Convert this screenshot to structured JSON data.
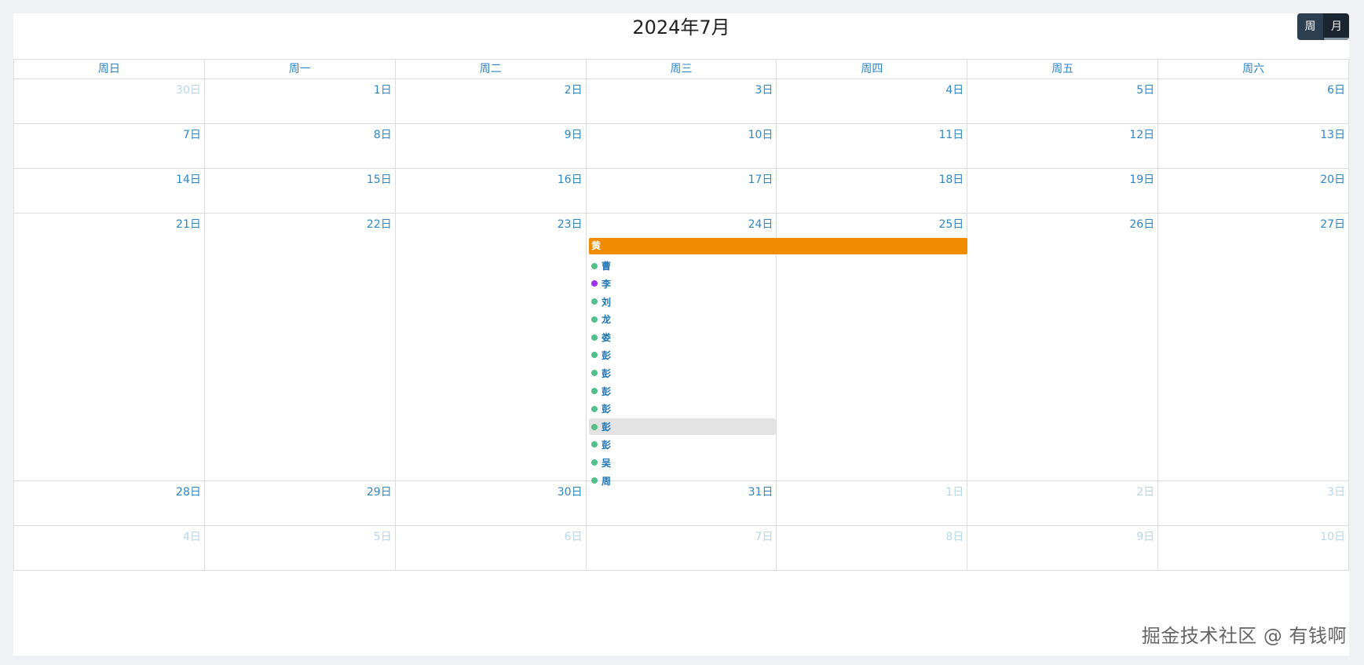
{
  "calendar": {
    "title": "2024年7月",
    "view_buttons": [
      {
        "label": "周",
        "active": false
      },
      {
        "label": "月",
        "active": true
      }
    ],
    "weekdays": [
      "周日",
      "周一",
      "周二",
      "周三",
      "周四",
      "周五",
      "周六"
    ],
    "weeks": [
      {
        "days": [
          {
            "label": "30日",
            "other": true
          },
          {
            "label": "1日"
          },
          {
            "label": "2日"
          },
          {
            "label": "3日"
          },
          {
            "label": "4日"
          },
          {
            "label": "5日"
          },
          {
            "label": "6日"
          }
        ]
      },
      {
        "days": [
          {
            "label": "7日"
          },
          {
            "label": "8日"
          },
          {
            "label": "9日"
          },
          {
            "label": "10日"
          },
          {
            "label": "11日"
          },
          {
            "label": "12日"
          },
          {
            "label": "13日"
          }
        ]
      },
      {
        "days": [
          {
            "label": "14日"
          },
          {
            "label": "15日"
          },
          {
            "label": "16日"
          },
          {
            "label": "17日"
          },
          {
            "label": "18日"
          },
          {
            "label": "19日"
          },
          {
            "label": "20日"
          }
        ]
      },
      {
        "days": [
          {
            "label": "21日"
          },
          {
            "label": "22日"
          },
          {
            "label": "23日"
          },
          {
            "label": "24日"
          },
          {
            "label": "25日"
          },
          {
            "label": "26日"
          },
          {
            "label": "27日"
          }
        ]
      },
      {
        "days": [
          {
            "label": "28日"
          },
          {
            "label": "29日"
          },
          {
            "label": "30日"
          },
          {
            "label": "31日"
          },
          {
            "label": "1日",
            "other": true
          },
          {
            "label": "2日",
            "other": true
          },
          {
            "label": "3日",
            "other": true
          }
        ]
      },
      {
        "days": [
          {
            "label": "4日",
            "other": true
          },
          {
            "label": "5日",
            "other": true
          },
          {
            "label": "6日",
            "other": true
          },
          {
            "label": "7日",
            "other": true
          },
          {
            "label": "8日",
            "other": true
          },
          {
            "label": "9日",
            "other": true
          },
          {
            "label": "10日",
            "other": true
          }
        ]
      }
    ],
    "multi_day_event": {
      "title": "黄",
      "color": "#f08c00",
      "start_day": "24日",
      "end_day": "25日"
    },
    "day_events": [
      {
        "title": "曹",
        "color": "#52c08a"
      },
      {
        "title": "李",
        "color": "#9b30f0"
      },
      {
        "title": "刘",
        "color": "#52c08a"
      },
      {
        "title": "龙",
        "color": "#52c08a"
      },
      {
        "title": "娄",
        "color": "#52c08a"
      },
      {
        "title": "彭",
        "color": "#52c08a"
      },
      {
        "title": "彭",
        "color": "#52c08a"
      },
      {
        "title": "彭",
        "color": "#52c08a"
      },
      {
        "title": "彭",
        "color": "#52c08a"
      },
      {
        "title": "彭",
        "color": "#52c08a",
        "highlighted": true
      },
      {
        "title": "彭",
        "color": "#52c08a"
      },
      {
        "title": "吴",
        "color": "#52c08a"
      },
      {
        "title": "周",
        "color": "#52c08a"
      }
    ]
  },
  "watermark": "掘金技术社区 @ 有钱啊",
  "colors": {
    "accent": "#2f86c7",
    "button_dark": "#2c3e50",
    "event_orange": "#f08c00"
  }
}
